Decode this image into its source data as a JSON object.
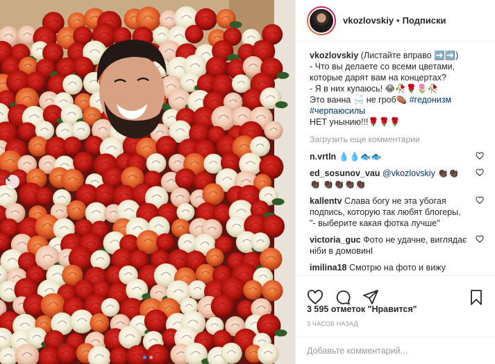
{
  "post": {
    "username": "vkozlovskiy",
    "separator": "•",
    "follow_status": "Подписки",
    "caption": {
      "username": "vkozlovskiy",
      "lines": [
        "(Листайте вправо ➡️➡️)",
        "- Что вы делаете со всеми цветами,",
        "которые дарят вам на концертах?",
        "- Я в них купаюсь! 😂🥀🌹🌷🥀",
        "Это ванна 🛁 не гроб⚰️",
        "#гедонизм",
        "#черпаюсилы",
        "НЕТ унынию!!!🌹🌹🌹"
      ]
    },
    "load_more": "Загрузить еще комментарии",
    "comments": [
      {
        "user": "n.vrtln",
        "text": "💧💧🐟🐟"
      },
      {
        "user": "ed_sosunov_vau",
        "mention": "@vkozlovskiy",
        "text": " 👏🏿👏🏿👏🏿 👏🏿👏🏿👏🏿👏🏿"
      },
      {
        "user": "kallentv",
        "text": "Слава богу не эта убогая подпись, которую так любят блогеры, \"- выберите какая фотка лучше\""
      },
      {
        "user": "victoria_guc",
        "text": "Фото не удачне, виглядає ніби в домовинІ"
      },
      {
        "user": "imilina18",
        "text": "Смотрю на фото и вижу"
      }
    ],
    "likes": "3 595 отметок \"Нравится\"",
    "time_ago": "3 ЧАСОВ НАЗАД",
    "comment_placeholder": "Добавьте комментарий...",
    "carousel": {
      "slides": 2,
      "active_index": 0
    }
  },
  "icons": {
    "prev": "chevron-left-icon",
    "like": "heart-icon",
    "comment": "comment-icon",
    "share": "share-icon",
    "save": "bookmark-icon"
  },
  "colors": {
    "link": "#003569",
    "muted": "#999999",
    "carousel_active": "#3897f0"
  }
}
